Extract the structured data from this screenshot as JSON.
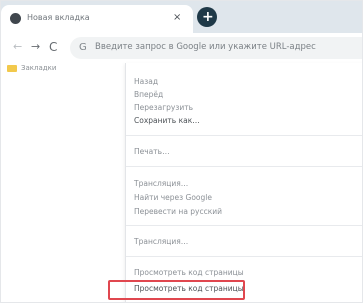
{
  "tab": {
    "title": "Новая вкладка",
    "close_glyph": "×"
  },
  "new_tab": {
    "label": "+"
  },
  "nav": {
    "back": "←",
    "forward": "→",
    "reload": "C"
  },
  "omnibox": {
    "icon": "G",
    "text": "Введите запрос в Google или укажите URL-адрес"
  },
  "bookmarks": {
    "label": "Закладки"
  },
  "menu": {
    "items": [
      "Назад",
      "Вперёд",
      "Перезагрузить",
      "Сохранить как…",
      "Печать…",
      "Трансляция…",
      "Найти через Google",
      "Перевести на русский",
      "Просмотреть код страницы"
    ]
  },
  "icons": {
    "tab": "chrome-favicon-icon",
    "close": "close-icon",
    "new_tab": "plus-icon",
    "back": "back-arrow-icon",
    "forward": "forward-arrow-icon",
    "reload": "reload-icon",
    "omnibox": "google-icon",
    "bookmark": "folder-icon"
  },
  "colors": {
    "tabstrip": "#dfe6ec",
    "new_tab_button": "#1f3948",
    "highlight": "#e0474f"
  }
}
